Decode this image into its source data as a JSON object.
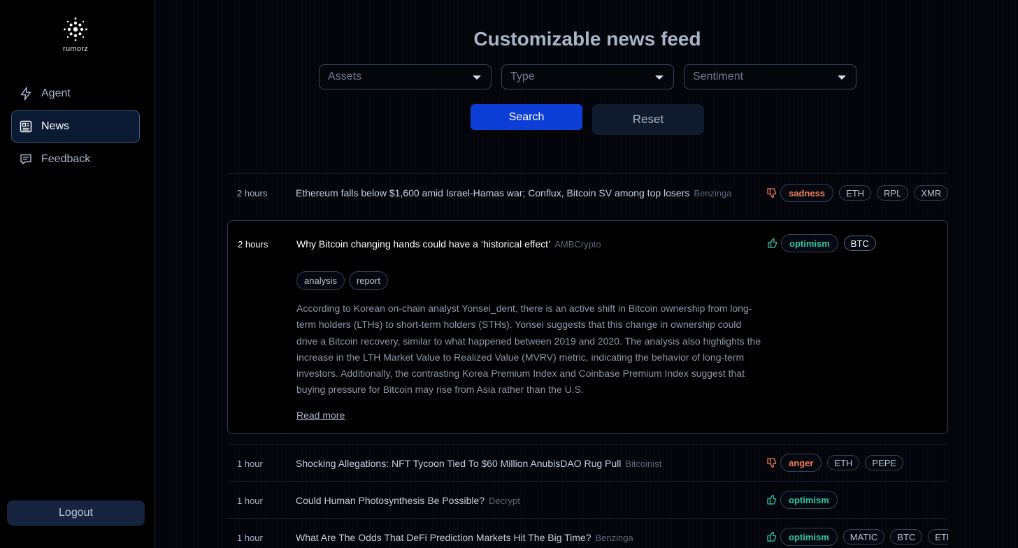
{
  "brand": {
    "name": "rumorz"
  },
  "sidebar": {
    "items": [
      {
        "label": "Agent",
        "icon": "bolt-icon"
      },
      {
        "label": "News",
        "icon": "newspaper-icon",
        "active": true
      },
      {
        "label": "Feedback",
        "icon": "chat-icon"
      }
    ],
    "logout_label": "Logout"
  },
  "header": {
    "title": "Customizable news feed"
  },
  "filters": {
    "assets_placeholder": "Assets",
    "type_placeholder": "Type",
    "sentiment_placeholder": "Sentiment"
  },
  "actions": {
    "search_label": "Search",
    "reset_label": "Reset"
  },
  "colors": {
    "accent": "#0d3fd6",
    "negative": "#f07c55",
    "positive": "#2dc7a6"
  },
  "feed": {
    "rows": [
      {
        "time": "2 hours",
        "title": "Ethereum falls below $1,600 amid Israel-Hamas war; Conflux, Bitcoin SV among top losers",
        "source": "Benzinga",
        "sentiment": "sadness",
        "assets": [
          "ETH",
          "RPL",
          "XMR"
        ]
      },
      {
        "time": "2 hours",
        "title": "Why Bitcoin changing hands could have a ‘historical effect’",
        "source": "AMBCrypto",
        "sentiment": "optimism",
        "assets": [
          "BTC"
        ],
        "keywords": [
          "analysis",
          "report"
        ],
        "summary": "According to Korean on-chain analyst Yonsei_dent, there is an active shift in Bitcoin ownership from long-term holders (LTHs) to short-term holders (STHs). Yonsei suggests that this change in ownership could drive a Bitcoin recovery, similar to what happened between 2019 and 2020. The analysis also highlights the increase in the LTH Market Value to Realized Value (MVRV) metric, indicating the behavior of long-term investors. Additionally, the contrasting Korea Premium Index and Coinbase Premium Index suggest that buying pressure for Bitcoin may rise from Asia rather than the U.S.",
        "read_more": "Read more"
      },
      {
        "time": "1 hour",
        "title": "Shocking Allegations: NFT Tycoon Tied To $60 Million AnubisDAO Rug Pull",
        "source": "Bitcoinist",
        "sentiment": "anger",
        "assets": [
          "ETH",
          "PEPE"
        ]
      },
      {
        "time": "1 hour",
        "title": "Could Human Photosynthesis Be Possible?",
        "source": "Decrypt",
        "sentiment": "optimism",
        "assets": []
      },
      {
        "time": "1 hour",
        "title": "What Are The Odds That DeFi Prediction Markets Hit The Big Time?",
        "source": "Benzinga",
        "sentiment": "optimism",
        "assets": [
          "MATIC",
          "BTC",
          "ETH"
        ]
      }
    ]
  }
}
